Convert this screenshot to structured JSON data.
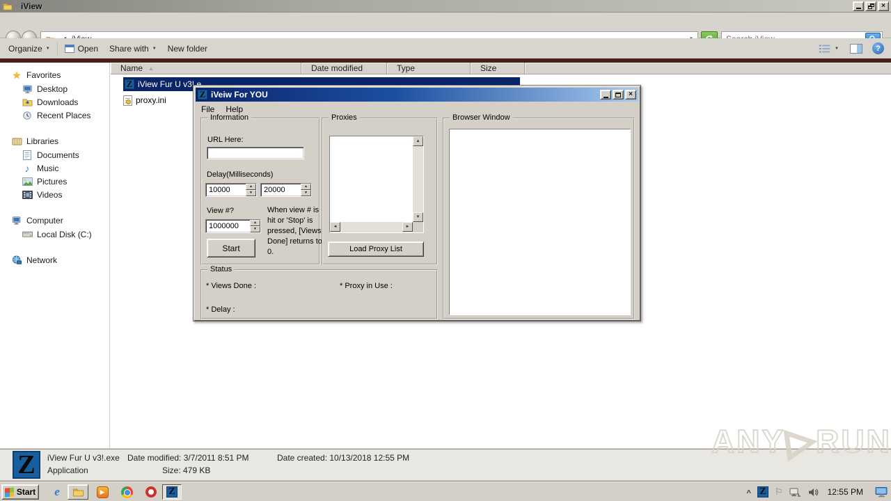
{
  "explorer": {
    "title": "iView",
    "address": "iView",
    "search_placeholder": "Search iView",
    "toolbar": {
      "organize": "Organize",
      "open": "Open",
      "share_with": "Share with",
      "new_folder": "New folder"
    },
    "columns": {
      "name": "Name",
      "date_modified": "Date modified",
      "type": "Type",
      "size": "Size"
    },
    "sidebar": {
      "favorites": "Favorites",
      "desktop": "Desktop",
      "downloads": "Downloads",
      "recent_places": "Recent Places",
      "libraries": "Libraries",
      "documents": "Documents",
      "music": "Music",
      "pictures": "Pictures",
      "videos": "Videos",
      "computer": "Computer",
      "local_disk": "Local Disk (C:)",
      "network": "Network"
    },
    "files": {
      "selected_name": "iView Fur U v3!.e",
      "ini_name": "proxy.ini"
    },
    "details": {
      "file_name": "iView Fur U v3!.exe",
      "date_modified": "Date modified: 3/7/2011 8:51 PM",
      "date_created": "Date created: 10/13/2018 12:55 PM",
      "type": "Application",
      "size": "Size: 479 KB"
    }
  },
  "dialog": {
    "title": "iVeiw For YOU",
    "menu": {
      "file": "File",
      "help": "Help"
    },
    "information": {
      "legend": "Information",
      "url_label": "URL Here:",
      "url_value": "",
      "delay_label": "Delay(Milliseconds)",
      "delay_value1": "10000",
      "delay_value2": "20000",
      "view_label": "View #?",
      "view_value": "1000000",
      "start_button": "Start",
      "note": "When view # is hit or 'Stop' is pressed, [Views Done] returns to 0."
    },
    "proxies": {
      "legend": "Proxies",
      "load_button": "Load Proxy List"
    },
    "browser": {
      "legend": "Browser Window"
    },
    "status": {
      "legend": "Status",
      "views_done": "* Views Done :",
      "proxy_in_use": "* Proxy in Use :",
      "delay": "* Delay :"
    }
  },
  "taskbar": {
    "start": "Start",
    "clock": "12:55 PM"
  },
  "watermark": {
    "left": "ANY",
    "right": "RUN"
  },
  "icons": {
    "caret_down": "▼",
    "sort_asc": "▲",
    "close_glyph": "×",
    "back_arrow": "←",
    "forward_arrow": "→",
    "star": "★",
    "music_note": "♪",
    "play": "▶",
    "play_outline": "▷",
    "flag": "⚐",
    "chevron": "^",
    "up": "▲",
    "down": "▼",
    "left": "◄",
    "right": "►",
    "z_logo": "Z",
    "question": "?",
    "ie_e": "e"
  },
  "colors": {
    "selection_blue": "#0a246a",
    "dialog_title_start": "#0a246a",
    "dialog_title_end": "#a6caf0",
    "chrome_gray": "#d4d0c8",
    "maroon_strip": "#49201c",
    "z_icon_blue": "#185d9e"
  }
}
